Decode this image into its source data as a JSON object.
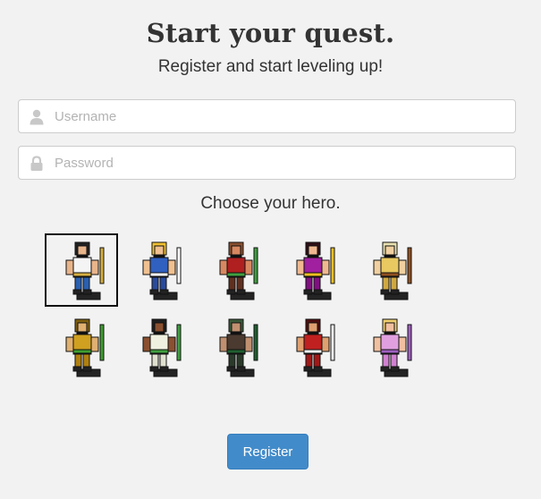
{
  "header": {
    "title": "Start your quest.",
    "subtitle": "Register and start leveling up!"
  },
  "form": {
    "username_placeholder": "Username",
    "password_placeholder": "Password",
    "choose_label": "Choose your hero.",
    "register_label": "Register"
  },
  "heroes": [
    {
      "name": "hero-1",
      "icon": "dark-haired-adventurer-icon",
      "selected": true,
      "palette": {
        "hair": "#222222",
        "skin": "#e8b48a",
        "body": "#f4f4f4",
        "legs": "#2a5fb0",
        "accent": "#d8b040"
      }
    },
    {
      "name": "hero-2",
      "icon": "blonde-swordsman-icon",
      "selected": false,
      "palette": {
        "hair": "#f0c030",
        "skin": "#f0c090",
        "body": "#3060c0",
        "legs": "#2a4a9a",
        "accent": "#ffffff"
      }
    },
    {
      "name": "hero-3",
      "icon": "bald-warrior-icon",
      "selected": false,
      "palette": {
        "hair": "#8a5030",
        "skin": "#d88860",
        "body": "#b02020",
        "legs": "#603020",
        "accent": "#40a040"
      }
    },
    {
      "name": "hero-4",
      "icon": "sorceress-purple-icon",
      "selected": false,
      "palette": {
        "hair": "#301018",
        "skin": "#f0b890",
        "body": "#a020a0",
        "legs": "#801080",
        "accent": "#f0c020"
      }
    },
    {
      "name": "hero-5",
      "icon": "wizard-staff-icon",
      "selected": false,
      "palette": {
        "hair": "#e8e0b0",
        "skin": "#f0d0a0",
        "body": "#e8c860",
        "legs": "#d0a840",
        "accent": "#905020"
      }
    },
    {
      "name": "hero-6",
      "icon": "golden-knight-icon",
      "selected": false,
      "palette": {
        "hair": "#806010",
        "skin": "#e0b070",
        "body": "#d0a020",
        "legs": "#b08010",
        "accent": "#40a030"
      }
    },
    {
      "name": "hero-7",
      "icon": "priestess-white-icon",
      "selected": false,
      "palette": {
        "hair": "#202020",
        "skin": "#8a5030",
        "body": "#f0f0e0",
        "legs": "#e0e0d0",
        "accent": "#40a040"
      }
    },
    {
      "name": "hero-8",
      "icon": "hooded-ranger-icon",
      "selected": false,
      "palette": {
        "hair": "#3a5a3a",
        "skin": "#c09070",
        "body": "#4a3a30",
        "legs": "#2a3a2a",
        "accent": "#206030"
      }
    },
    {
      "name": "hero-9",
      "icon": "shield-warrior-icon",
      "selected": false,
      "palette": {
        "hair": "#501010",
        "skin": "#e0a070",
        "body": "#c02020",
        "legs": "#a01818",
        "accent": "#f0f0f0"
      }
    },
    {
      "name": "hero-10",
      "icon": "pink-mage-icon",
      "selected": false,
      "palette": {
        "hair": "#f0d070",
        "skin": "#f0c0a0",
        "body": "#e0a0e0",
        "legs": "#d080d0",
        "accent": "#a060c0"
      }
    }
  ],
  "colors": {
    "background": "#f2f2f2",
    "button": "#428bca",
    "button_text": "#ffffff"
  }
}
